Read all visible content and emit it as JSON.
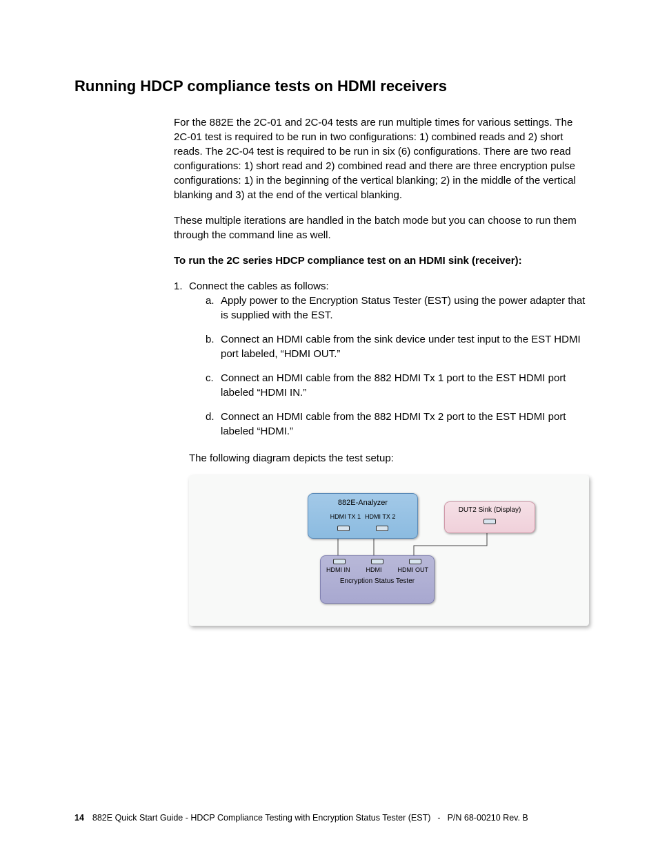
{
  "heading": "Running HDCP compliance tests on HDMI receivers",
  "para1": "For the 882E the 2C-01 and 2C-04 tests are run multiple times for various settings. The 2C-01 test is required to be run in two configurations: 1) combined reads and 2) short reads. The 2C-04 test is required to be run in six (6) configurations. There are two read configurations: 1) short read and 2) combined read and there are three encryption pulse configurations: 1) in the beginning of the vertical blanking; 2) in the middle of the vertical blanking and 3) at the end of the vertical blanking.",
  "para2": "These multiple iterations are handled in the batch mode but you can choose to run them through the command line as well.",
  "subhead": "To run the 2C series HDCP compliance test on an HDMI sink (receiver):",
  "step1": "Connect the cables as follows:",
  "sub_a": "Apply power to the Encryption Status Tester (EST) using the power adapter that is supplied with the EST.",
  "sub_b": "Connect an HDMI cable from the sink device under test input to the EST HDMI port labeled, “HDMI OUT.”",
  "sub_c": "Connect an HDMI cable from the 882 HDMI Tx 1 port to the EST HDMI port labeled “HDMI IN.”",
  "sub_d": "Connect an HDMI cable from the 882 HDMI Tx 2 port to the EST HDMI port labeled “HDMI.”",
  "diagram_caption": "The following diagram depicts the test setup:",
  "diagram": {
    "analyzer_title": "882E-Analyzer",
    "tx1": "HDMI TX 1",
    "tx2": "HDMI TX 2",
    "dut_title": "DUT2 Sink (Display)",
    "est_in": "HDMI IN",
    "est_mid": "HDMI",
    "est_out": "HDMI OUT",
    "est_name": "Encryption Status Tester"
  },
  "footer": {
    "page": "14",
    "doc": "882E Quick Start Guide - HDCP Compliance Testing with Encryption Status Tester (EST)",
    "dash": "-",
    "rev": "P/N 68-00210 Rev. B"
  }
}
